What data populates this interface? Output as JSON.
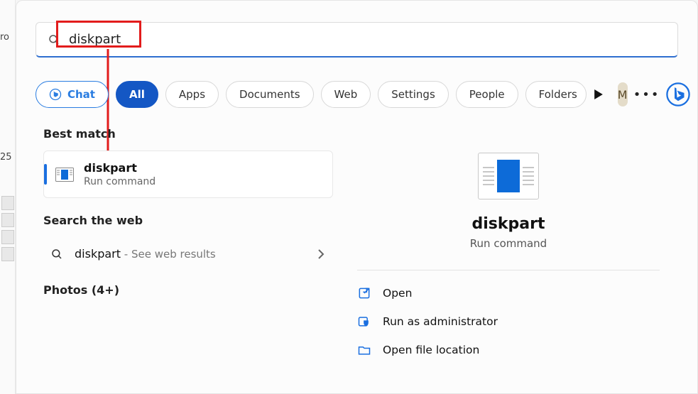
{
  "left_fragments": {
    "f1": "ro",
    "f2": "25"
  },
  "search": {
    "query": "diskpart"
  },
  "filters": {
    "chat": "Chat",
    "tabs": [
      "All",
      "Apps",
      "Documents",
      "Web",
      "Settings",
      "People",
      "Folders"
    ],
    "active_index": 0
  },
  "avatar_initial": "M",
  "sections": {
    "best_match": "Best match",
    "search_web": "Search the web",
    "photos": "Photos (4+)"
  },
  "best_match_item": {
    "title": "diskpart",
    "subtitle": "Run command"
  },
  "web_item": {
    "term": "diskpart",
    "suffix": " - See web results"
  },
  "detail": {
    "title": "diskpart",
    "subtitle": "Run command",
    "actions": [
      {
        "id": "open",
        "label": "Open"
      },
      {
        "id": "run-admin",
        "label": "Run as administrator"
      },
      {
        "id": "open-file-location",
        "label": "Open file location"
      }
    ]
  }
}
